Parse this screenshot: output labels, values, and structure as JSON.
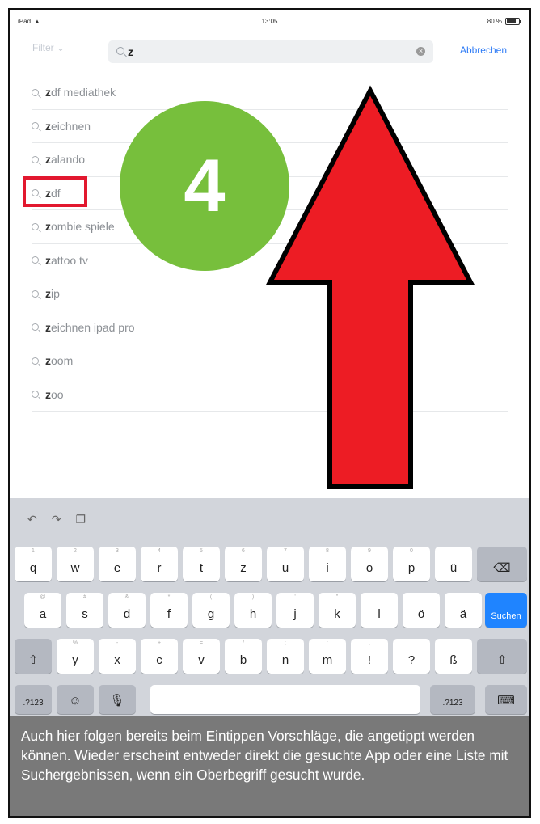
{
  "status_bar": {
    "device": "iPad",
    "time": "13:05",
    "battery": "80 %"
  },
  "header": {
    "filter_label": "Filter",
    "search_query": "z",
    "cancel_label": "Abbrechen"
  },
  "suggestions": [
    {
      "bold": "z",
      "rest": "df mediathek"
    },
    {
      "bold": "z",
      "rest": "eichnen"
    },
    {
      "bold": "z",
      "rest": "alando"
    },
    {
      "bold": "z",
      "rest": "df"
    },
    {
      "bold": "z",
      "rest": "ombie spiele"
    },
    {
      "bold": "z",
      "rest": "attoo tv"
    },
    {
      "bold": "z",
      "rest": "ip"
    },
    {
      "bold": "z",
      "rest": "eichnen ipad pro"
    },
    {
      "bold": "z",
      "rest": "oom"
    },
    {
      "bold": "z",
      "rest": "oo"
    }
  ],
  "overlay": {
    "step_number": "4",
    "circle_color": "#77bf3c",
    "arrow_color": "#ed1c24",
    "highlight_color": "#e2182f"
  },
  "keyboard": {
    "tools": [
      "undo-icon",
      "redo-icon",
      "paste-icon"
    ],
    "row1": [
      {
        "k": "q",
        "h": "1"
      },
      {
        "k": "w",
        "h": "2"
      },
      {
        "k": "e",
        "h": "3"
      },
      {
        "k": "r",
        "h": "4"
      },
      {
        "k": "t",
        "h": "5"
      },
      {
        "k": "z",
        "h": "6"
      },
      {
        "k": "u",
        "h": "7"
      },
      {
        "k": "i",
        "h": "8"
      },
      {
        "k": "o",
        "h": "9"
      },
      {
        "k": "p",
        "h": "0"
      },
      {
        "k": "ü",
        "h": ""
      }
    ],
    "row2": [
      {
        "k": "a",
        "h": "@"
      },
      {
        "k": "s",
        "h": "#"
      },
      {
        "k": "d",
        "h": "&"
      },
      {
        "k": "f",
        "h": "*"
      },
      {
        "k": "g",
        "h": "("
      },
      {
        "k": "h",
        "h": ")"
      },
      {
        "k": "j",
        "h": "'"
      },
      {
        "k": "k",
        "h": "\""
      },
      {
        "k": "l",
        "h": ""
      },
      {
        "k": "ö",
        "h": ""
      },
      {
        "k": "ä",
        "h": ""
      }
    ],
    "row3": [
      {
        "k": "y",
        "h": "%"
      },
      {
        "k": "x",
        "h": "-"
      },
      {
        "k": "c",
        "h": "+"
      },
      {
        "k": "v",
        "h": "="
      },
      {
        "k": "b",
        "h": "/"
      },
      {
        "k": "n",
        "h": ";"
      },
      {
        "k": "m",
        "h": ":"
      },
      {
        "k": "!",
        "h": ","
      },
      {
        "k": "?",
        "h": "."
      },
      {
        "k": "ß",
        "h": ""
      }
    ],
    "search_label": "Suchen",
    "numbers_label": ".?123"
  },
  "caption": "Auch hier folgen bereits beim Eintippen Vorschläge, die angetippt werden können. Wieder erscheint entweder direkt die gesuchte App oder eine Liste mit Suchergebnissen, wenn ein Oberbegriff gesucht wurde."
}
